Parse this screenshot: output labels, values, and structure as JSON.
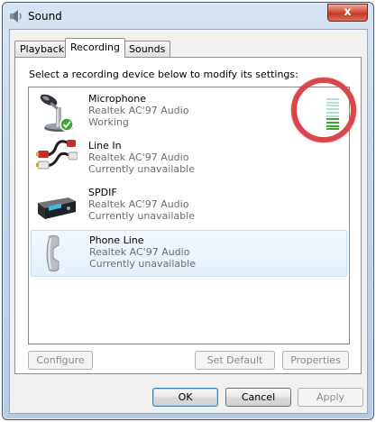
{
  "window": {
    "title": "Sound",
    "close_glyph": "x"
  },
  "tabs": [
    {
      "label": "Playback",
      "active": false
    },
    {
      "label": "Recording",
      "active": true
    },
    {
      "label": "Sounds",
      "active": false
    }
  ],
  "instruction": "Select a recording device below to modify its settings:",
  "devices": [
    {
      "name": "Microphone",
      "driver": "Realtek AC'97 Audio",
      "status": "Working",
      "icon": "microphone-icon",
      "default": true,
      "level_fraction": 0.4
    },
    {
      "name": "Line In",
      "driver": "Realtek AC'97 Audio",
      "status": "Currently unavailable",
      "icon": "rca-cable-icon"
    },
    {
      "name": "SPDIF",
      "driver": "Realtek AC'97 Audio",
      "status": "Currently unavailable",
      "icon": "spdif-device-icon"
    },
    {
      "name": "Phone Line",
      "driver": "Realtek AC'97 Audio",
      "status": "Currently unavailable",
      "icon": "phone-handset-icon",
      "selected": true
    }
  ],
  "buttons": {
    "configure": "Configure",
    "set_default": "Set Default",
    "properties": "Properties",
    "ok": "OK",
    "cancel": "Cancel",
    "apply": "Apply"
  },
  "colors": {
    "meter_active": "#3aa832",
    "meter_inactive": "#b8ddd9",
    "highlight_circle": "#d9464b"
  }
}
